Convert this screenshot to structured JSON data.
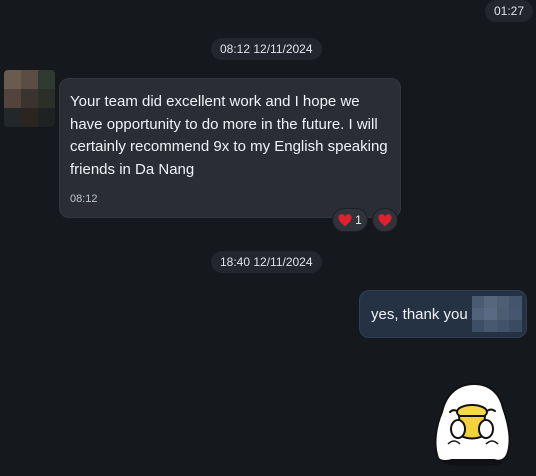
{
  "header": {
    "time": "01:27"
  },
  "messages": [
    {
      "date_label": "08:12 12/11/2024",
      "direction": "incoming",
      "text": "Your team did excellent work and I hope we have opportunity to do more in the future. I will certainly recommend 9x to my English speaking friends in Da Nang",
      "time": "08:12",
      "reactions": [
        {
          "emoji": "heart",
          "count": "1"
        },
        {
          "emoji": "heart",
          "count": ""
        }
      ]
    },
    {
      "date_label": "18:40 12/11/2024",
      "direction": "outgoing",
      "text": "yes, thank you"
    },
    {
      "direction": "outgoing",
      "type": "sticker",
      "sticker": "duck-sticker"
    }
  ],
  "colors": {
    "background": "#15181c",
    "incoming_bubble": "#2a2e34",
    "outgoing_bubble": "#243244",
    "time_chip": "#23272d",
    "reaction_heart": "#e0202e"
  }
}
